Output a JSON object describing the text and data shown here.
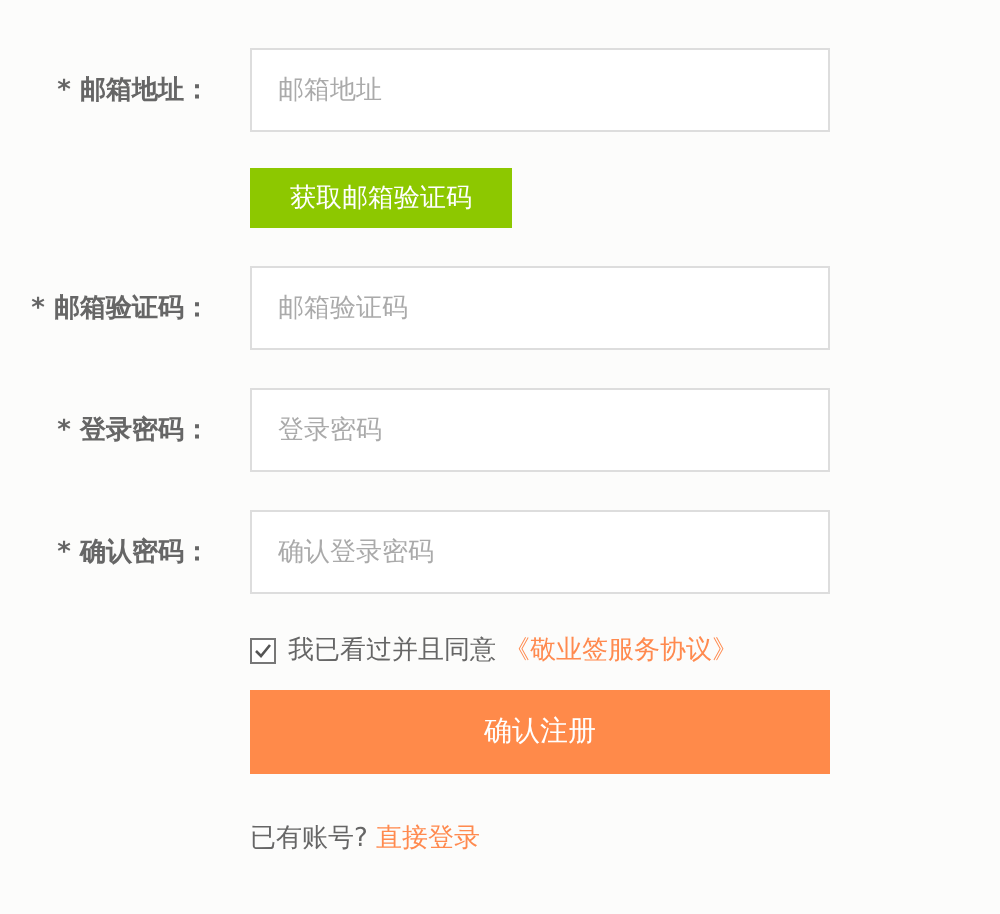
{
  "form_rows": [
    {
      "kind": "field",
      "label": "* 邮箱地址：",
      "placeholder": "邮箱地址"
    },
    {
      "kind": "button",
      "text": "获取邮箱验证码"
    },
    {
      "kind": "field",
      "label": "* 邮箱验证码：",
      "placeholder": "邮箱验证码"
    },
    {
      "kind": "field",
      "label": "* 登录密码：",
      "placeholder": "登录密码"
    },
    {
      "kind": "field",
      "label": "* 确认密码：",
      "placeholder": "确认登录密码"
    }
  ],
  "agreement": {
    "checked": true,
    "text": "我已看过并且同意",
    "link": "《敬业签服务协议》"
  },
  "submit": "确认注册",
  "footer": {
    "text": "已有账号?",
    "link": "直接登录"
  }
}
